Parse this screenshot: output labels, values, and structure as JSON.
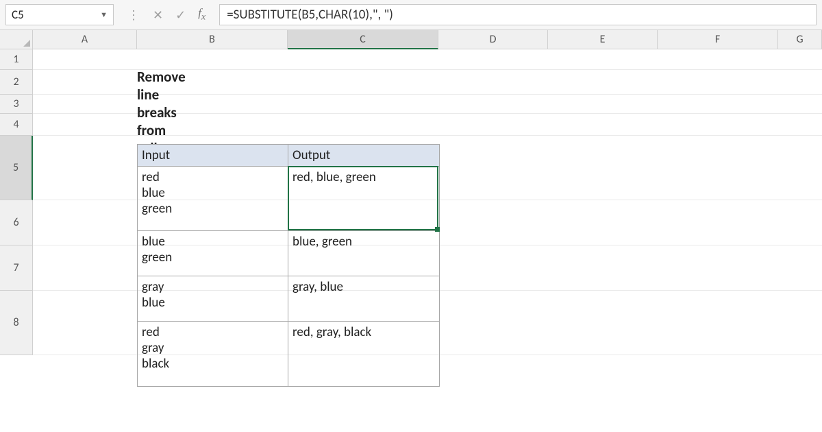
{
  "namebox": {
    "value": "C5"
  },
  "formula": "=SUBSTITUTE(B5,CHAR(10),\", \")",
  "columns": [
    "A",
    "B",
    "C",
    "D",
    "E",
    "F",
    "G"
  ],
  "rows": [
    "1",
    "2",
    "3",
    "4",
    "5",
    "6",
    "7",
    "8"
  ],
  "active": {
    "col": "C",
    "row": "5"
  },
  "title": "Remove line breaks from cell",
  "table": {
    "headers": {
      "input": "Input",
      "output": "Output"
    },
    "data": [
      {
        "input": "red\nblue\ngreen",
        "output": "red, blue, green"
      },
      {
        "input": "blue\ngreen",
        "output": "blue, green"
      },
      {
        "input": "gray\nblue",
        "output": "gray, blue"
      },
      {
        "input": "red\ngray\nblack",
        "output": "red, gray, black"
      }
    ]
  },
  "chart_data": {
    "type": "table",
    "title": "Remove line breaks from cell",
    "columns": [
      "Input",
      "Output"
    ],
    "rows": [
      [
        "red\\nblue\\ngreen",
        "red, blue, green"
      ],
      [
        "blue\\ngreen",
        "blue, green"
      ],
      [
        "gray\\nblue",
        "gray, blue"
      ],
      [
        "red\\ngray\\nblack",
        "red, gray, black"
      ]
    ],
    "formula": "=SUBSTITUTE(B5,CHAR(10),\", \")",
    "active_cell": "C5"
  }
}
